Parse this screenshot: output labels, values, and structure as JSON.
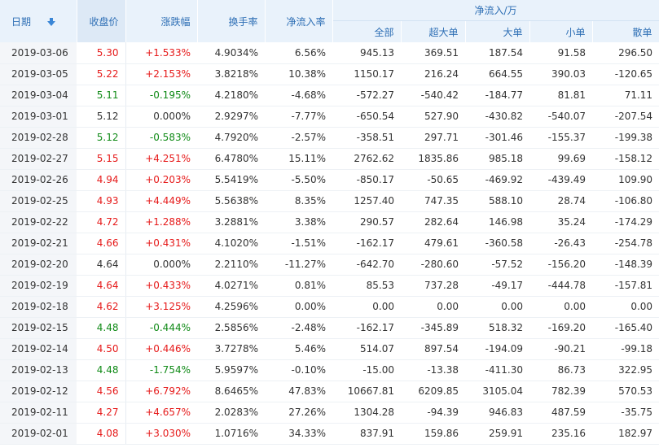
{
  "headers": {
    "date": "日期",
    "close": "收盘价",
    "change": "涨跌幅",
    "turnover": "换手率",
    "net_rate": "净流入率",
    "net_flow_group": "净流入/万",
    "all": "全部",
    "xlarge": "超大单",
    "large": "大单",
    "small": "小单",
    "retail": "散单"
  },
  "sort": {
    "icon": "sort-down-arrow-icon",
    "color": "#3a86d6"
  },
  "colors": {
    "up": "#e61919",
    "down": "#0f8a16",
    "header_bg": "#e9f2fb",
    "header_text": "#2e6fb5"
  },
  "rows": [
    {
      "date": "2019-03-06",
      "close": "5.30",
      "change": "+1.533%",
      "turnover": "4.9034%",
      "net_rate": "6.56%",
      "all": "945.13",
      "xlarge": "369.51",
      "large": "187.54",
      "small": "91.58",
      "retail": "296.50",
      "trend": "up"
    },
    {
      "date": "2019-03-05",
      "close": "5.22",
      "change": "+2.153%",
      "turnover": "3.8218%",
      "net_rate": "10.38%",
      "all": "1150.17",
      "xlarge": "216.24",
      "large": "664.55",
      "small": "390.03",
      "retail": "-120.65",
      "trend": "up"
    },
    {
      "date": "2019-03-04",
      "close": "5.11",
      "change": "-0.195%",
      "turnover": "4.2180%",
      "net_rate": "-4.68%",
      "all": "-572.27",
      "xlarge": "-540.42",
      "large": "-184.77",
      "small": "81.81",
      "retail": "71.11",
      "trend": "down"
    },
    {
      "date": "2019-03-01",
      "close": "5.12",
      "change": "0.000%",
      "turnover": "2.9297%",
      "net_rate": "-7.77%",
      "all": "-650.54",
      "xlarge": "527.90",
      "large": "-430.82",
      "small": "-540.07",
      "retail": "-207.54",
      "trend": "flat"
    },
    {
      "date": "2019-02-28",
      "close": "5.12",
      "change": "-0.583%",
      "turnover": "4.7920%",
      "net_rate": "-2.57%",
      "all": "-358.51",
      "xlarge": "297.71",
      "large": "-301.46",
      "small": "-155.37",
      "retail": "-199.38",
      "trend": "down"
    },
    {
      "date": "2019-02-27",
      "close": "5.15",
      "change": "+4.251%",
      "turnover": "6.4780%",
      "net_rate": "15.11%",
      "all": "2762.62",
      "xlarge": "1835.86",
      "large": "985.18",
      "small": "99.69",
      "retail": "-158.12",
      "trend": "up"
    },
    {
      "date": "2019-02-26",
      "close": "4.94",
      "change": "+0.203%",
      "turnover": "5.5419%",
      "net_rate": "-5.50%",
      "all": "-850.17",
      "xlarge": "-50.65",
      "large": "-469.92",
      "small": "-439.49",
      "retail": "109.90",
      "trend": "up"
    },
    {
      "date": "2019-02-25",
      "close": "4.93",
      "change": "+4.449%",
      "turnover": "5.5638%",
      "net_rate": "8.35%",
      "all": "1257.40",
      "xlarge": "747.35",
      "large": "588.10",
      "small": "28.74",
      "retail": "-106.80",
      "trend": "up"
    },
    {
      "date": "2019-02-22",
      "close": "4.72",
      "change": "+1.288%",
      "turnover": "3.2881%",
      "net_rate": "3.38%",
      "all": "290.57",
      "xlarge": "282.64",
      "large": "146.98",
      "small": "35.24",
      "retail": "-174.29",
      "trend": "up"
    },
    {
      "date": "2019-02-21",
      "close": "4.66",
      "change": "+0.431%",
      "turnover": "4.1020%",
      "net_rate": "-1.51%",
      "all": "-162.17",
      "xlarge": "479.61",
      "large": "-360.58",
      "small": "-26.43",
      "retail": "-254.78",
      "trend": "up"
    },
    {
      "date": "2019-02-20",
      "close": "4.64",
      "change": "0.000%",
      "turnover": "2.2110%",
      "net_rate": "-11.27%",
      "all": "-642.70",
      "xlarge": "-280.60",
      "large": "-57.52",
      "small": "-156.20",
      "retail": "-148.39",
      "trend": "flat"
    },
    {
      "date": "2019-02-19",
      "close": "4.64",
      "change": "+0.433%",
      "turnover": "4.0271%",
      "net_rate": "0.81%",
      "all": "85.53",
      "xlarge": "737.28",
      "large": "-49.17",
      "small": "-444.78",
      "retail": "-157.81",
      "trend": "up"
    },
    {
      "date": "2019-02-18",
      "close": "4.62",
      "change": "+3.125%",
      "turnover": "4.2596%",
      "net_rate": "0.00%",
      "all": "0.00",
      "xlarge": "0.00",
      "large": "0.00",
      "small": "0.00",
      "retail": "0.00",
      "trend": "up"
    },
    {
      "date": "2019-02-15",
      "close": "4.48",
      "change": "-0.444%",
      "turnover": "2.5856%",
      "net_rate": "-2.48%",
      "all": "-162.17",
      "xlarge": "-345.89",
      "large": "518.32",
      "small": "-169.20",
      "retail": "-165.40",
      "trend": "down"
    },
    {
      "date": "2019-02-14",
      "close": "4.50",
      "change": "+0.446%",
      "turnover": "3.7278%",
      "net_rate": "5.46%",
      "all": "514.07",
      "xlarge": "897.54",
      "large": "-194.09",
      "small": "-90.21",
      "retail": "-99.18",
      "trend": "up"
    },
    {
      "date": "2019-02-13",
      "close": "4.48",
      "change": "-1.754%",
      "turnover": "5.9597%",
      "net_rate": "-0.10%",
      "all": "-15.00",
      "xlarge": "-13.38",
      "large": "-411.30",
      "small": "86.73",
      "retail": "322.95",
      "trend": "down"
    },
    {
      "date": "2019-02-12",
      "close": "4.56",
      "change": "+6.792%",
      "turnover": "8.6465%",
      "net_rate": "47.83%",
      "all": "10667.81",
      "xlarge": "6209.85",
      "large": "3105.04",
      "small": "782.39",
      "retail": "570.53",
      "trend": "up"
    },
    {
      "date": "2019-02-11",
      "close": "4.27",
      "change": "+4.657%",
      "turnover": "2.0283%",
      "net_rate": "27.26%",
      "all": "1304.28",
      "xlarge": "-94.39",
      "large": "946.83",
      "small": "487.59",
      "retail": "-35.75",
      "trend": "up"
    },
    {
      "date": "2019-02-01",
      "close": "4.08",
      "change": "+3.030%",
      "turnover": "1.0716%",
      "net_rate": "34.33%",
      "all": "837.91",
      "xlarge": "159.86",
      "large": "259.91",
      "small": "235.16",
      "retail": "182.97",
      "trend": "up"
    }
  ]
}
